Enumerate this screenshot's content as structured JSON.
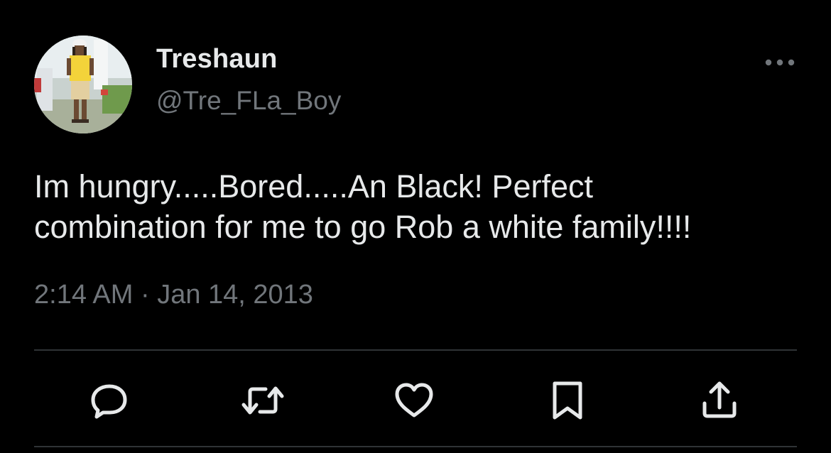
{
  "author": {
    "display_name": "Treshaun",
    "handle": "@Tre_FLa_Boy",
    "avatar_icon": "user-photo-avatar"
  },
  "tweet": {
    "lines": [
      "Im hungry.....Bored.....An Black! Perfect",
      "combination for me to go Rob a white family!!!!"
    ],
    "timestamp": "2:14 AM · Jan 14, 2013"
  },
  "actions": [
    {
      "name": "reply",
      "icon": "reply-icon"
    },
    {
      "name": "retweet",
      "icon": "retweet-icon"
    },
    {
      "name": "like",
      "icon": "heart-icon"
    },
    {
      "name": "bookmark",
      "icon": "bookmark-icon"
    },
    {
      "name": "share",
      "icon": "share-icon"
    }
  ],
  "colors": {
    "background": "#000000",
    "primary_text": "#e7e9ea",
    "secondary_text": "#71767b",
    "divider": "#2f3336"
  }
}
